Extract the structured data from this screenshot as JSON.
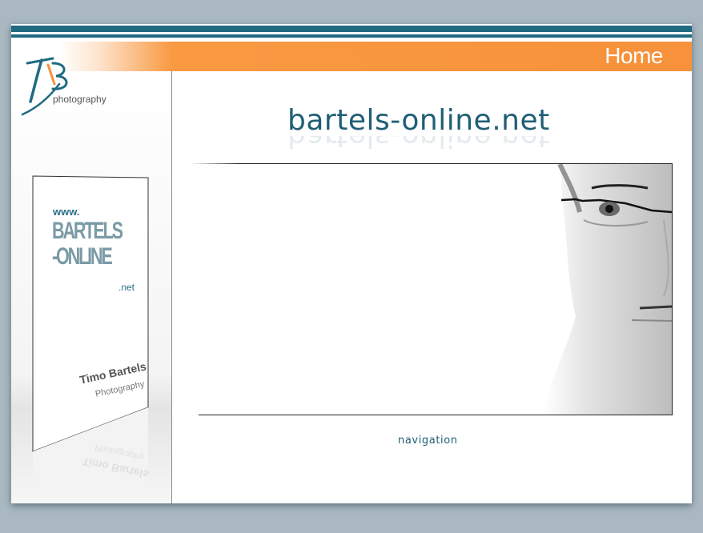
{
  "header": {
    "page_title": "Home"
  },
  "logo": {
    "monogram": "TB",
    "caption": "photography"
  },
  "sidebar_card": {
    "www": "www.",
    "line1": "BARTELS",
    "line2": "-ONLINE",
    "tld": ".net",
    "name": "Timo Bartels",
    "subtitle": "Photography"
  },
  "main": {
    "site_title": "bartels-online.net",
    "nav_label": "navigation"
  },
  "colors": {
    "accent_orange": "#f7913b",
    "teal": "#1f6a80",
    "background": "#a9b8c1"
  }
}
